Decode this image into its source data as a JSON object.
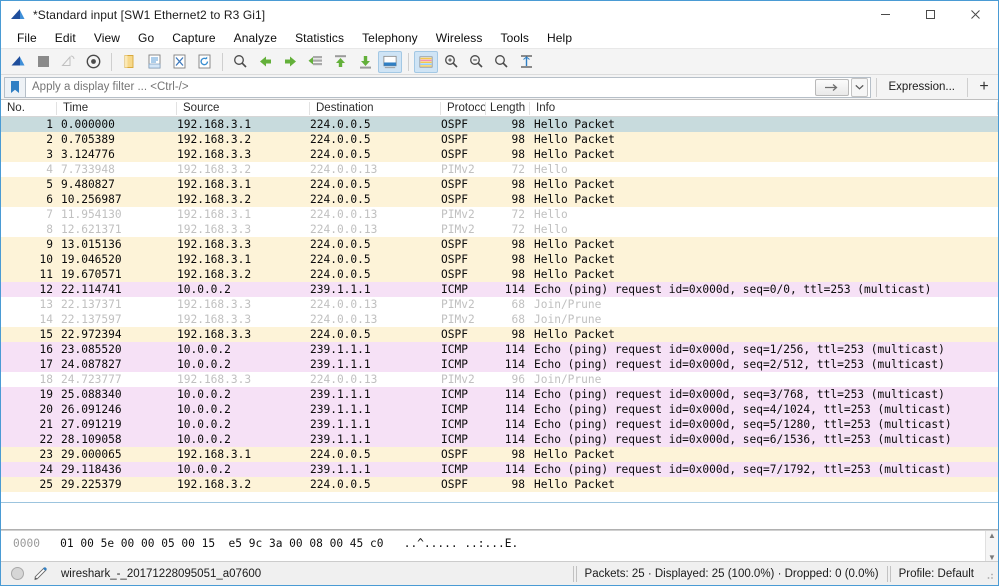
{
  "window": {
    "title": "*Standard input [SW1 Ethernet2 to R3 Gi1]",
    "app_icon": "wireshark-fin-icon",
    "minimize_label": "–",
    "maximize_label": "□",
    "close_label": "×"
  },
  "menu": {
    "items": [
      {
        "label": "File"
      },
      {
        "label": "Edit"
      },
      {
        "label": "View"
      },
      {
        "label": "Go"
      },
      {
        "label": "Capture"
      },
      {
        "label": "Analyze"
      },
      {
        "label": "Statistics"
      },
      {
        "label": "Telephony"
      },
      {
        "label": "Wireless"
      },
      {
        "label": "Tools"
      },
      {
        "label": "Help"
      }
    ]
  },
  "toolbar": {
    "buttons": [
      {
        "name": "start-capture",
        "icon": "shark-fin-icon",
        "state": "normal"
      },
      {
        "name": "stop-capture",
        "icon": "stop-square-icon",
        "state": "normal"
      },
      {
        "name": "restart-capture",
        "icon": "restart-shark-icon",
        "state": "disabled"
      },
      {
        "name": "capture-options",
        "icon": "gear-target-icon",
        "state": "normal"
      },
      {
        "name": "sep1",
        "icon": "separator",
        "state": "sep"
      },
      {
        "name": "open-file",
        "icon": "folder-icon",
        "state": "normal"
      },
      {
        "name": "save-file",
        "icon": "save-document-icon",
        "state": "normal"
      },
      {
        "name": "close-file",
        "icon": "close-x-document-icon",
        "state": "normal"
      },
      {
        "name": "reload-file",
        "icon": "reload-circular-arrow-icon",
        "state": "normal"
      },
      {
        "name": "sep2",
        "icon": "separator",
        "state": "sep"
      },
      {
        "name": "find-packet",
        "icon": "magnifier-icon",
        "state": "normal"
      },
      {
        "name": "go-back",
        "icon": "arrow-left-icon",
        "state": "normal"
      },
      {
        "name": "go-forward",
        "icon": "arrow-right-icon",
        "state": "normal"
      },
      {
        "name": "go-to-packet",
        "icon": "goto-packet-icon",
        "state": "normal"
      },
      {
        "name": "go-to-first",
        "icon": "arrow-up-top-icon",
        "state": "normal"
      },
      {
        "name": "go-to-last",
        "icon": "arrow-down-bottom-icon",
        "state": "normal"
      },
      {
        "name": "auto-scroll",
        "icon": "auto-scroll-icon",
        "state": "active"
      },
      {
        "name": "sep3",
        "icon": "separator",
        "state": "sep"
      },
      {
        "name": "colorize-packets",
        "icon": "colorize-rows-icon",
        "state": "active"
      },
      {
        "name": "zoom-in",
        "icon": "zoom-in-icon",
        "state": "normal"
      },
      {
        "name": "zoom-out",
        "icon": "zoom-out-icon",
        "state": "normal"
      },
      {
        "name": "zoom-reset",
        "icon": "zoom-reset-icon",
        "state": "normal"
      },
      {
        "name": "resize-columns",
        "icon": "resize-columns-icon",
        "state": "normal"
      }
    ]
  },
  "filter": {
    "bookmark_icon": "bookmark-icon",
    "placeholder": "Apply a display filter ... <Ctrl-/>",
    "value": "",
    "apply_icon": "right-arrow-icon",
    "dropdown_icon": "chevron-down-icon",
    "expression_label": "Expression...",
    "add_label": "+"
  },
  "packet_list": {
    "columns": [
      {
        "key": "no",
        "label": "No."
      },
      {
        "key": "time",
        "label": "Time"
      },
      {
        "key": "source",
        "label": "Source"
      },
      {
        "key": "destination",
        "label": "Destination"
      },
      {
        "key": "protocol",
        "label": "Protocol"
      },
      {
        "key": "length",
        "label": "Length"
      },
      {
        "key": "info",
        "label": "Info"
      }
    ],
    "rows": [
      {
        "no": "1",
        "time": "0.000000",
        "source": "192.168.3.1",
        "destination": "224.0.0.5",
        "protocol": "OSPF",
        "length": "98",
        "info": "Hello Packet",
        "style": "selected"
      },
      {
        "no": "2",
        "time": "0.705389",
        "source": "192.168.3.2",
        "destination": "224.0.0.5",
        "protocol": "OSPF",
        "length": "98",
        "info": "Hello Packet",
        "style": "ospf"
      },
      {
        "no": "3",
        "time": "3.124776",
        "source": "192.168.3.3",
        "destination": "224.0.0.5",
        "protocol": "OSPF",
        "length": "98",
        "info": "Hello Packet",
        "style": "ospf"
      },
      {
        "no": "4",
        "time": "7.733948",
        "source": "192.168.3.2",
        "destination": "224.0.0.13",
        "protocol": "PIMv2",
        "length": "72",
        "info": "Hello",
        "style": "pim"
      },
      {
        "no": "5",
        "time": "9.480827",
        "source": "192.168.3.1",
        "destination": "224.0.0.5",
        "protocol": "OSPF",
        "length": "98",
        "info": "Hello Packet",
        "style": "ospf"
      },
      {
        "no": "6",
        "time": "10.256987",
        "source": "192.168.3.2",
        "destination": "224.0.0.5",
        "protocol": "OSPF",
        "length": "98",
        "info": "Hello Packet",
        "style": "ospf"
      },
      {
        "no": "7",
        "time": "11.954130",
        "source": "192.168.3.1",
        "destination": "224.0.0.13",
        "protocol": "PIMv2",
        "length": "72",
        "info": "Hello",
        "style": "pim"
      },
      {
        "no": "8",
        "time": "12.621371",
        "source": "192.168.3.3",
        "destination": "224.0.0.13",
        "protocol": "PIMv2",
        "length": "72",
        "info": "Hello",
        "style": "pim"
      },
      {
        "no": "9",
        "time": "13.015136",
        "source": "192.168.3.3",
        "destination": "224.0.0.5",
        "protocol": "OSPF",
        "length": "98",
        "info": "Hello Packet",
        "style": "ospf"
      },
      {
        "no": "10",
        "time": "19.046520",
        "source": "192.168.3.1",
        "destination": "224.0.0.5",
        "protocol": "OSPF",
        "length": "98",
        "info": "Hello Packet",
        "style": "ospf"
      },
      {
        "no": "11",
        "time": "19.670571",
        "source": "192.168.3.2",
        "destination": "224.0.0.5",
        "protocol": "OSPF",
        "length": "98",
        "info": "Hello Packet",
        "style": "ospf"
      },
      {
        "no": "12",
        "time": "22.114741",
        "source": "10.0.0.2",
        "destination": "239.1.1.1",
        "protocol": "ICMP",
        "length": "114",
        "info": "Echo (ping) request  id=0x000d, seq=0/0, ttl=253 (multicast)",
        "style": "icmp"
      },
      {
        "no": "13",
        "time": "22.137371",
        "source": "192.168.3.3",
        "destination": "224.0.0.13",
        "protocol": "PIMv2",
        "length": "68",
        "info": "Join/Prune",
        "style": "pim"
      },
      {
        "no": "14",
        "time": "22.137597",
        "source": "192.168.3.3",
        "destination": "224.0.0.13",
        "protocol": "PIMv2",
        "length": "68",
        "info": "Join/Prune",
        "style": "pim"
      },
      {
        "no": "15",
        "time": "22.972394",
        "source": "192.168.3.3",
        "destination": "224.0.0.5",
        "protocol": "OSPF",
        "length": "98",
        "info": "Hello Packet",
        "style": "ospf"
      },
      {
        "no": "16",
        "time": "23.085520",
        "source": "10.0.0.2",
        "destination": "239.1.1.1",
        "protocol": "ICMP",
        "length": "114",
        "info": "Echo (ping) request  id=0x000d, seq=1/256, ttl=253 (multicast)",
        "style": "icmp"
      },
      {
        "no": "17",
        "time": "24.087827",
        "source": "10.0.0.2",
        "destination": "239.1.1.1",
        "protocol": "ICMP",
        "length": "114",
        "info": "Echo (ping) request  id=0x000d, seq=2/512, ttl=253 (multicast)",
        "style": "icmp"
      },
      {
        "no": "18",
        "time": "24.723777",
        "source": "192.168.3.3",
        "destination": "224.0.0.13",
        "protocol": "PIMv2",
        "length": "96",
        "info": "Join/Prune",
        "style": "pim"
      },
      {
        "no": "19",
        "time": "25.088340",
        "source": "10.0.0.2",
        "destination": "239.1.1.1",
        "protocol": "ICMP",
        "length": "114",
        "info": "Echo (ping) request  id=0x000d, seq=3/768, ttl=253 (multicast)",
        "style": "icmp"
      },
      {
        "no": "20",
        "time": "26.091246",
        "source": "10.0.0.2",
        "destination": "239.1.1.1",
        "protocol": "ICMP",
        "length": "114",
        "info": "Echo (ping) request  id=0x000d, seq=4/1024, ttl=253 (multicast)",
        "style": "icmp"
      },
      {
        "no": "21",
        "time": "27.091219",
        "source": "10.0.0.2",
        "destination": "239.1.1.1",
        "protocol": "ICMP",
        "length": "114",
        "info": "Echo (ping) request  id=0x000d, seq=5/1280, ttl=253 (multicast)",
        "style": "icmp"
      },
      {
        "no": "22",
        "time": "28.109058",
        "source": "10.0.0.2",
        "destination": "239.1.1.1",
        "protocol": "ICMP",
        "length": "114",
        "info": "Echo (ping) request  id=0x000d, seq=6/1536, ttl=253 (multicast)",
        "style": "icmp"
      },
      {
        "no": "23",
        "time": "29.000065",
        "source": "192.168.3.1",
        "destination": "224.0.0.5",
        "protocol": "OSPF",
        "length": "98",
        "info": "Hello Packet",
        "style": "ospf"
      },
      {
        "no": "24",
        "time": "29.118436",
        "source": "10.0.0.2",
        "destination": "239.1.1.1",
        "protocol": "ICMP",
        "length": "114",
        "info": "Echo (ping) request  id=0x000d, seq=7/1792, ttl=253 (multicast)",
        "style": "icmp"
      },
      {
        "no": "25",
        "time": "29.225379",
        "source": "192.168.3.2",
        "destination": "224.0.0.5",
        "protocol": "OSPF",
        "length": "98",
        "info": "Hello Packet",
        "style": "ospf"
      }
    ]
  },
  "bytes_pane": {
    "offset": "0000",
    "hex": "01 00 5e 00 00 05 00 15  e5 9c 3a 00 08 00 45 c0",
    "ascii": "..^..... ..:...E.",
    "scroll_up_icon": "chevron-up-icon",
    "scroll_down_icon": "chevron-down-icon"
  },
  "statusbar": {
    "ready_icon": "capture-status-circle-icon",
    "expert_icon": "annotation-pencil-icon",
    "file_label": "wireshark_-_20171228095051_a07600",
    "stats_label": "Packets: 25 · Displayed: 25 (100.0%) · Dropped: 0 (0.0%)",
    "profile_label": "Profile: Default"
  },
  "colors": {
    "selected_row_bg": "#c8dbdd",
    "ospf_row_bg": "#fdf3d8",
    "pim_row_bg": "#ffffff",
    "icmp_row_bg": "#f6e1f6",
    "dim_text": "#c0c0c0",
    "normal_text": "#0b0b0b",
    "accent_blue": "#1f78c1",
    "window_border": "#4a9bd4"
  }
}
